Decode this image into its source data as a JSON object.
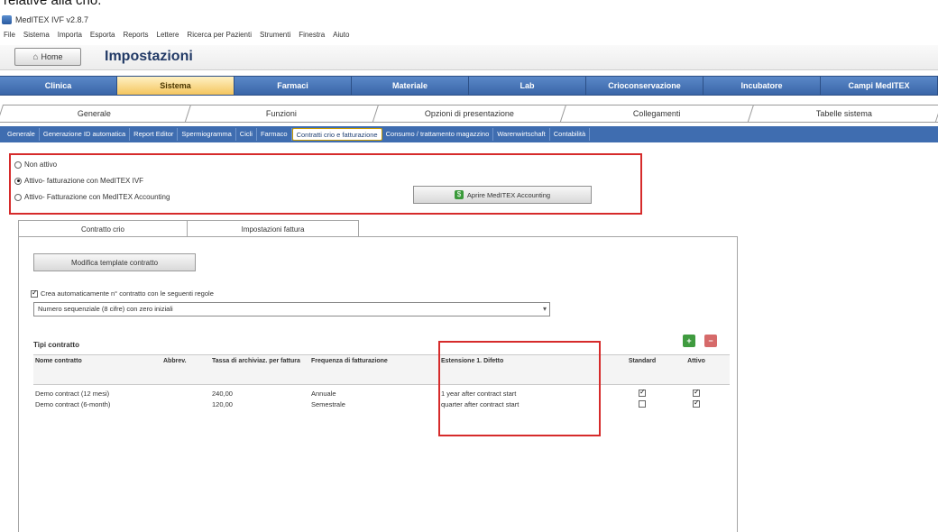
{
  "caption": "relative alla cho.",
  "app": {
    "title": "MedITEX IVF v2.8.7"
  },
  "menu": [
    "File",
    "Sistema",
    "Importa",
    "Esporta",
    "Reports",
    "Lettere",
    "Ricerca per Pazienti",
    "Strumenti",
    "Finestra",
    "Aiuto"
  ],
  "toolbar": {
    "home_label": "Home",
    "page_title": "Impostazioni"
  },
  "main_tabs": [
    "Clinica",
    "Sistema",
    "Farmaci",
    "Materiale",
    "Lab",
    "Crioconservazione",
    "Incubatore",
    "Campi MedITEX"
  ],
  "sub_tabs": [
    "Generale",
    "Funzioni",
    "Opzioni di presentazione",
    "Collegamenti",
    "Tabelle sistema"
  ],
  "func_tabs": [
    "Generale",
    "Generazione ID automatica",
    "Report Editor",
    "Spermiogramma",
    "Cicli",
    "Farmaco",
    "Contratti crio e fatturazione",
    "Consumo / trattamento magazzino",
    "Warenwirtschaft",
    "Contabilità"
  ],
  "radios": [
    {
      "label": "Non attivo",
      "selected": false
    },
    {
      "label": "Attivo- fatturazione con MedITEX IVF",
      "selected": true
    },
    {
      "label": "Attivo- Fatturazione con MedITEX Accounting",
      "selected": false
    }
  ],
  "accounting_button": "Aprire MedITEX Accounting",
  "inner_tabs": [
    "Contratto crio",
    "Impostazioni fattura"
  ],
  "edit_template_button": "Modifica template contratto",
  "auto_number": {
    "label": "Crea automaticamente n° contratto con le seguenti regole",
    "checked": true,
    "selected_rule": "Numero sequenziale (8 cifre) con zero iniziali"
  },
  "grid": {
    "title": "Tipi contratto",
    "headers": [
      "Nome contratto",
      "Abbrev.",
      "Tassa di archiviaz. per fattura",
      "Frequenza di fatturazione",
      "Estensione 1. Difetto",
      "Standard",
      "Attivo"
    ],
    "rows": [
      {
        "name": "Demo contract (12 mesi)",
        "abbr": "",
        "fee": "240,00",
        "freq": "Annuale",
        "ext": "1 year after contract start",
        "standard": true,
        "active": true
      },
      {
        "name": "Demo contract (6-month)",
        "abbr": "",
        "fee": "120,00",
        "freq": "Semestrale",
        "ext": "quarter after contract start",
        "standard": false,
        "active": true
      }
    ]
  },
  "accent": {
    "nav_blue": "#3f6db0",
    "active_tab": "#f4c55e",
    "highlight_red": "#d62b2b"
  }
}
